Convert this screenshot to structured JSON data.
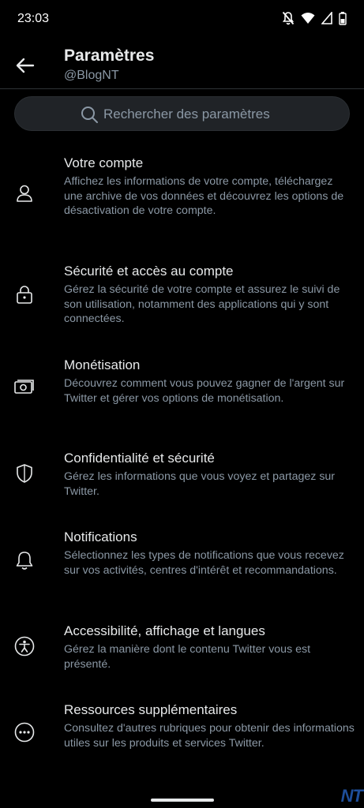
{
  "status_bar": {
    "time": "23:03",
    "icons": [
      "notifications-off-icon",
      "wifi-icon",
      "signal-icon",
      "battery-icon"
    ]
  },
  "header": {
    "title": "Paramètres",
    "subtitle": "@BlogNT",
    "back_icon": "arrow-left-icon"
  },
  "search": {
    "placeholder": "Rechercher des paramètres",
    "icon": "search-icon"
  },
  "items": [
    {
      "title": "Votre compte",
      "description": "Affichez les informations de votre compte, téléchargez une archive de vos données et découvrez les options de désactivation de votre compte.",
      "icon": "person-icon"
    },
    {
      "title": "Sécurité et accès au compte",
      "description": "Gérez la sécurité de votre compte et assurez le suivi de son utilisation, notamment des applications qui y sont connectées.",
      "icon": "lock-icon"
    },
    {
      "title": "Monétisation",
      "description": "Découvrez comment vous pouvez gagner de l'argent sur Twitter et gérer vos options de monétisation.",
      "icon": "money-icon"
    },
    {
      "title": "Confidentialité et sécurité",
      "description": "Gérez les informations que vous voyez et partagez sur Twitter.",
      "icon": "shield-icon"
    },
    {
      "title": "Notifications",
      "description": "Sélectionnez les types de notifications que vous recevez sur vos activités, centres d'intérêt et recommandations.",
      "icon": "bell-icon"
    },
    {
      "title": "Accessibilité, affichage et langues",
      "description": "Gérez la manière dont le contenu Twitter vous est présenté.",
      "icon": "accessibility-icon"
    },
    {
      "title": "Ressources supplémentaires",
      "description": "Consultez d'autres rubriques pour obtenir des informations utiles sur les produits et services Twitter.",
      "icon": "more-icon"
    }
  ],
  "watermark": "NT",
  "colors": {
    "background": "#000000",
    "text_primary": "#e7e9ea",
    "text_secondary": "#8b98a5",
    "search_bg": "#202327"
  }
}
